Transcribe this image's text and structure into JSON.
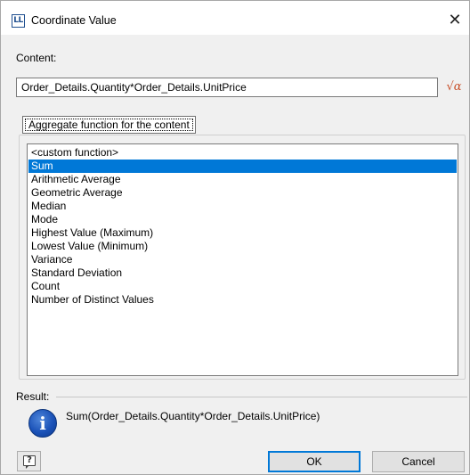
{
  "window": {
    "title": "Coordinate Value",
    "icon_text": "LL",
    "close_glyph": "✕"
  },
  "content": {
    "label": "Content:",
    "value": "Order_Details.Quantity*Order_Details.UnitPrice",
    "formula_button_glyph": "√α"
  },
  "aggregate": {
    "group_label": "Aggregate function for the content",
    "selected_index": 1,
    "items": [
      "<custom function>",
      "Sum",
      "Arithmetic Average",
      "Geometric Average",
      "Median",
      "Mode",
      "Highest Value (Maximum)",
      "Lowest Value (Minimum)",
      "Variance",
      "Standard Deviation",
      "Count",
      "Number of Distinct Values"
    ]
  },
  "result": {
    "label": "Result:",
    "icon_glyph": "i",
    "text": "Sum(Order_Details.Quantity*Order_Details.UnitPrice)"
  },
  "buttons": {
    "help_glyph": "?",
    "ok_label": "OK",
    "cancel_label": "Cancel"
  },
  "colors": {
    "selection": "#0078d7",
    "formula_icon": "#c8502a",
    "info_icon": "#1b52b8"
  }
}
